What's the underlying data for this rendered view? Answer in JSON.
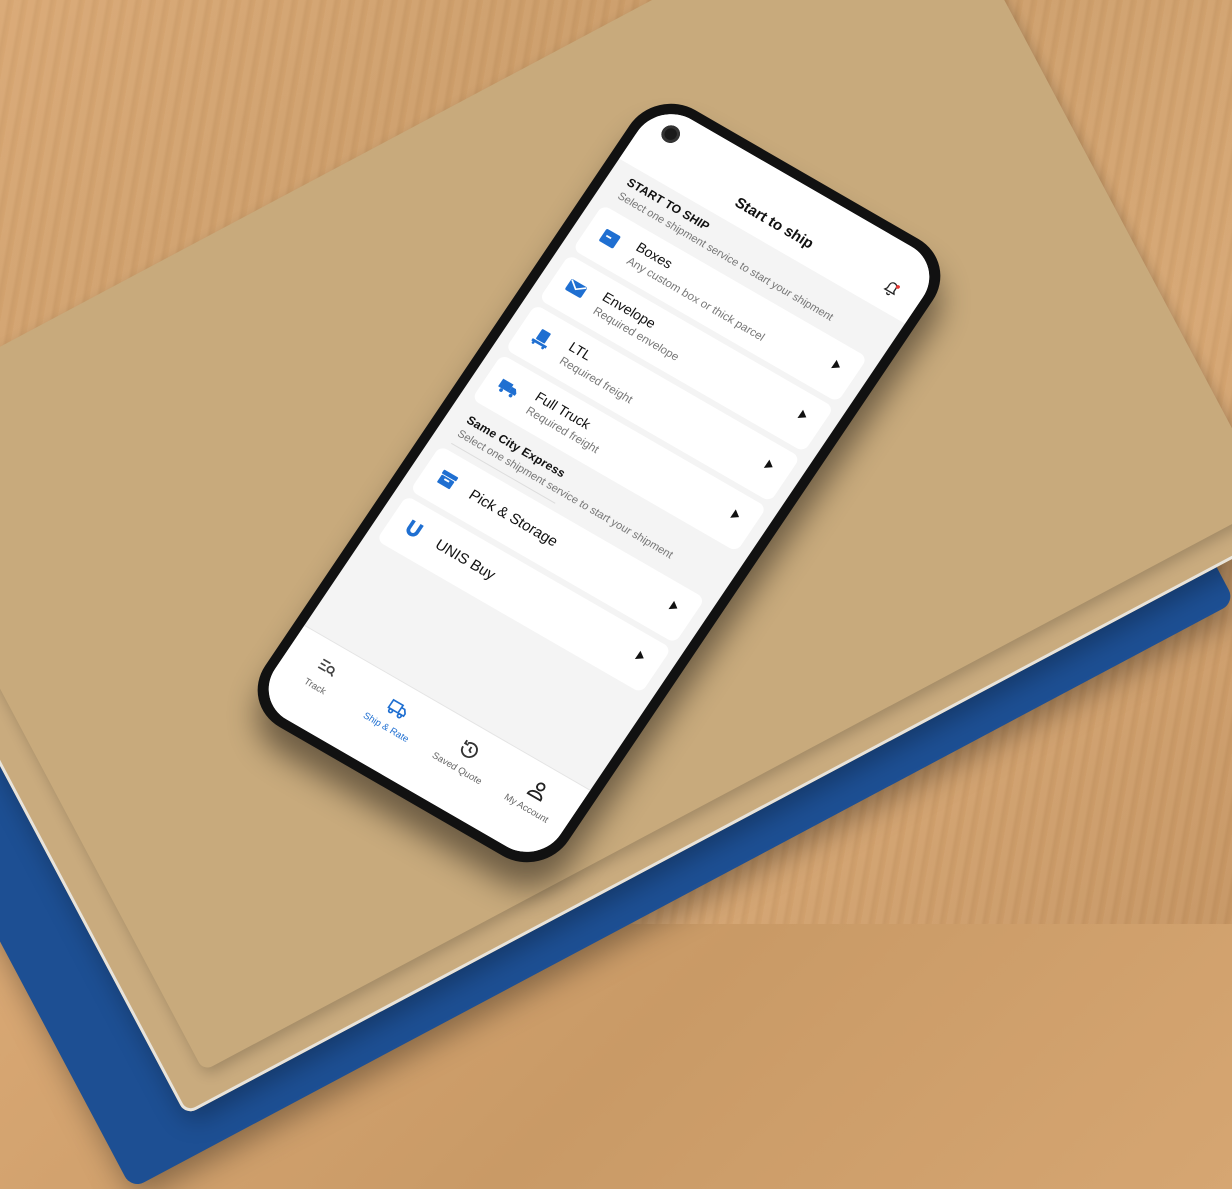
{
  "header": {
    "title": "Start to ship"
  },
  "sections": [
    {
      "heading": "START TO SHIP",
      "subtitle": "Select one shipment service to start your shipment",
      "items": [
        {
          "title": "Boxes",
          "desc": "Any custom box or thick parcel",
          "icon": "box-icon"
        },
        {
          "title": "Envelope",
          "desc": "Required envelope",
          "icon": "envelope-icon"
        },
        {
          "title": "LTL",
          "desc": "Required freight",
          "icon": "pallet-icon"
        },
        {
          "title": "Full Truck",
          "desc": "Required freight",
          "icon": "truck-icon"
        }
      ]
    },
    {
      "heading": "Same City Express",
      "subtitle": "Select one shipment service to start your shipment",
      "items": [
        {
          "title": "Pick & Storage",
          "icon": "storage-icon"
        },
        {
          "title": "UNIS Buy",
          "icon": "unis-logo-icon"
        }
      ]
    }
  ],
  "tabs": [
    {
      "label": "Track",
      "icon": "track-icon"
    },
    {
      "label": "Ship & Rate",
      "icon": "ship-rate-icon",
      "active": true
    },
    {
      "label": "Saved Quote",
      "icon": "history-icon"
    },
    {
      "label": "My Account",
      "icon": "account-icon"
    }
  ],
  "colors": {
    "accent": "#1f6fd1",
    "notification_dot": "#e53935"
  }
}
